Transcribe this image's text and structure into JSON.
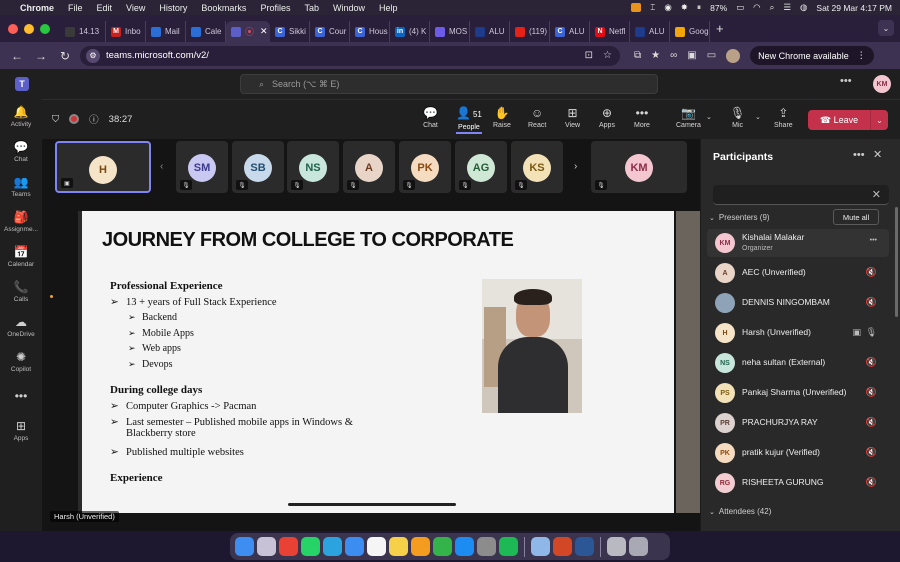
{
  "menubar": {
    "app": "Chrome",
    "items": [
      "File",
      "Edit",
      "View",
      "History",
      "Bookmarks",
      "Profiles",
      "Tab",
      "Window",
      "Help"
    ],
    "battery": "87%",
    "datetime": "Sat 29 Mar  4:17 PM"
  },
  "tabs": [
    {
      "fav": "",
      "label": "14.13",
      "color": "#3a3a3a"
    },
    {
      "fav": "M",
      "label": "Inbo",
      "color": "#c5221f"
    },
    {
      "fav": "",
      "label": "Mail",
      "color": "#2b6fd6"
    },
    {
      "fav": "",
      "label": "Cale",
      "color": "#2b6fd6"
    },
    {
      "fav": "",
      "label": "",
      "color": "#5b5fc7"
    },
    {
      "fav": "C",
      "label": "Sikki",
      "color": "#3b64d8"
    },
    {
      "fav": "C",
      "label": "Cour",
      "color": "#3b64d8"
    },
    {
      "fav": "C",
      "label": "Hous",
      "color": "#3b64d8"
    },
    {
      "fav": "in",
      "label": "(4) K",
      "color": "#0a66c2"
    },
    {
      "fav": "",
      "label": "MOS",
      "color": "#6c5ce7"
    },
    {
      "fav": "",
      "label": "ALU",
      "color": "#1e3a8a"
    },
    {
      "fav": "",
      "label": "(119)",
      "color": "#e62117"
    },
    {
      "fav": "C",
      "label": "ALU",
      "color": "#3b64d8"
    },
    {
      "fav": "N",
      "label": "Netfl",
      "color": "#e50914"
    },
    {
      "fav": "",
      "label": "ALU",
      "color": "#1e3a8a"
    },
    {
      "fav": "",
      "label": "Goog",
      "color": "#f2a60c"
    }
  ],
  "address": {
    "url": "teams.microsoft.com/v2/",
    "new_chrome_label": "New Chrome available"
  },
  "teams": {
    "search_placeholder": "Search (⌥ ⌘ E)",
    "user_initials": "KM"
  },
  "rail": [
    {
      "icon": "bell-icon",
      "glyph": "🔔",
      "label": "Activity"
    },
    {
      "icon": "chat-icon",
      "glyph": "💬",
      "label": "Chat"
    },
    {
      "icon": "teams-icon",
      "glyph": "👥",
      "label": "Teams"
    },
    {
      "icon": "assignments-icon",
      "glyph": "🎒",
      "label": "Assignme..."
    },
    {
      "icon": "calendar-icon",
      "glyph": "📅",
      "label": "Calendar"
    },
    {
      "icon": "calls-icon",
      "glyph": "📞",
      "label": "Calls"
    },
    {
      "icon": "onedrive-icon",
      "glyph": "☁",
      "label": "OneDrive"
    },
    {
      "icon": "copilot-icon",
      "glyph": "✺",
      "label": "Copilot"
    },
    {
      "icon": "more-icon",
      "glyph": "•••",
      "label": ""
    },
    {
      "icon": "apps-icon",
      "glyph": "⊞",
      "label": "Apps"
    }
  ],
  "meeting": {
    "timer": "38:27",
    "controls": {
      "chat": "Chat",
      "people": "People",
      "people_count": "51",
      "raise": "Raise",
      "react": "React",
      "view": "View",
      "apps": "Apps",
      "more": "More",
      "camera": "Camera",
      "mic": "Mic",
      "share": "Share"
    },
    "leave_label": "Leave"
  },
  "strip_tiles": [
    {
      "initials": "H",
      "bg": "#f6e4c9",
      "fg": "#7a4a12",
      "selected": true
    },
    {
      "initials": "SM",
      "bg": "#c9c8f2",
      "fg": "#3c3a8c"
    },
    {
      "initials": "SB",
      "bg": "#c7d9ea",
      "fg": "#24506f"
    },
    {
      "initials": "NS",
      "bg": "#c9e6dc",
      "fg": "#21624c"
    },
    {
      "initials": "A",
      "bg": "#e8d5c8",
      "fg": "#6b3c22"
    },
    {
      "initials": "PK",
      "bg": "#f5dcc0",
      "fg": "#8a4a12"
    },
    {
      "initials": "AG",
      "bg": "#cfe8d6",
      "fg": "#245c36"
    },
    {
      "initials": "KS",
      "bg": "#f3e1b7",
      "fg": "#7a5a10"
    },
    {
      "initials": "KM",
      "bg": "#f3c6d0",
      "fg": "#8a2d46"
    }
  ],
  "slide": {
    "title": "JOURNEY FROM COLLEGE TO CORPORATE",
    "sections": [
      {
        "heading": "Professional Experience",
        "points": [
          {
            "text": "13 + years of Full Stack Experience",
            "subs": [
              "Backend",
              "Mobile Apps",
              "Web apps",
              "Devops"
            ]
          }
        ]
      },
      {
        "heading": "During college days",
        "points": [
          {
            "text": "Computer Graphics -> Pacman",
            "subs": []
          },
          {
            "text": "Last semester – Published mobile apps in Windows &",
            "cont": "Blackberry store",
            "subs": []
          },
          {
            "text": "Published multiple websites",
            "subs": []
          }
        ]
      },
      {
        "heading": "Experience",
        "points": []
      }
    ],
    "presenter_tag": "Harsh (Unverified)"
  },
  "panel": {
    "title": "Participants",
    "presenters_label": "Presenters (9)",
    "mute_all": "Mute all",
    "attendees_label": "Attendees (42)",
    "people": [
      {
        "initials": "KM",
        "name": "Kishalai Malakar",
        "role": "Organizer",
        "bg": "#f3c6d0",
        "fg": "#8a2d46"
      },
      {
        "initials": "A",
        "name": "AEC (Unverified)",
        "role": "",
        "bg": "#e8d5c8",
        "fg": "#6b3c22"
      },
      {
        "initials": "",
        "name": "DENNIS NINGOMBAM",
        "role": "",
        "bg": "#8fa3b8",
        "fg": "#ffffff"
      },
      {
        "initials": "H",
        "name": "Harsh (Unverified)",
        "role": "",
        "bg": "#f6e4c9",
        "fg": "#7a4a12"
      },
      {
        "initials": "NS",
        "name": "neha sultan (External)",
        "role": "",
        "bg": "#c9e6dc",
        "fg": "#21624c"
      },
      {
        "initials": "PS",
        "name": "Pankaj Sharma (Unverified)",
        "role": "",
        "bg": "#f3e1b7",
        "fg": "#7a5a10"
      },
      {
        "initials": "PR",
        "name": "PRACHURJYA RAY",
        "role": "",
        "bg": "#dcd2cf",
        "fg": "#5a3f38"
      },
      {
        "initials": "PK",
        "name": "pratik kujur (Verified)",
        "role": "",
        "bg": "#f5dcc0",
        "fg": "#8a4a12"
      },
      {
        "initials": "RG",
        "name": "RISHEETA GURUNG",
        "role": "",
        "bg": "#f2cdd2",
        "fg": "#8a2d3a"
      }
    ]
  },
  "dock": [
    {
      "icon": "finder-icon",
      "color": "#3d8ef0"
    },
    {
      "icon": "launchpad-icon",
      "color": "#c7c2d6"
    },
    {
      "icon": "chrome-icon",
      "color": "#e94235"
    },
    {
      "icon": "whatsapp-icon",
      "color": "#25d366"
    },
    {
      "icon": "telegram-icon",
      "color": "#2aa3df"
    },
    {
      "icon": "mail-icon",
      "color": "#3b8df1"
    },
    {
      "icon": "reminders-icon",
      "color": "#f5f5f5"
    },
    {
      "icon": "notes-icon",
      "color": "#f7d04a"
    },
    {
      "icon": "pages-icon",
      "color": "#f39c1f"
    },
    {
      "icon": "numbers-icon",
      "color": "#33b34a"
    },
    {
      "icon": "appstore-icon",
      "color": "#1c8cf2"
    },
    {
      "icon": "settings-icon",
      "color": "#8c8c8c"
    },
    {
      "icon": "spotify-icon",
      "color": "#1db954"
    },
    {
      "icon": "preview-icon",
      "color": "#8fb8e8"
    },
    {
      "icon": "powerpoint-icon",
      "color": "#d24726"
    },
    {
      "icon": "word-icon",
      "color": "#2b5797"
    },
    {
      "icon": "downloads-icon",
      "color": "#b9b9c2"
    },
    {
      "icon": "trash-icon",
      "color": "#a9a9b3"
    }
  ]
}
